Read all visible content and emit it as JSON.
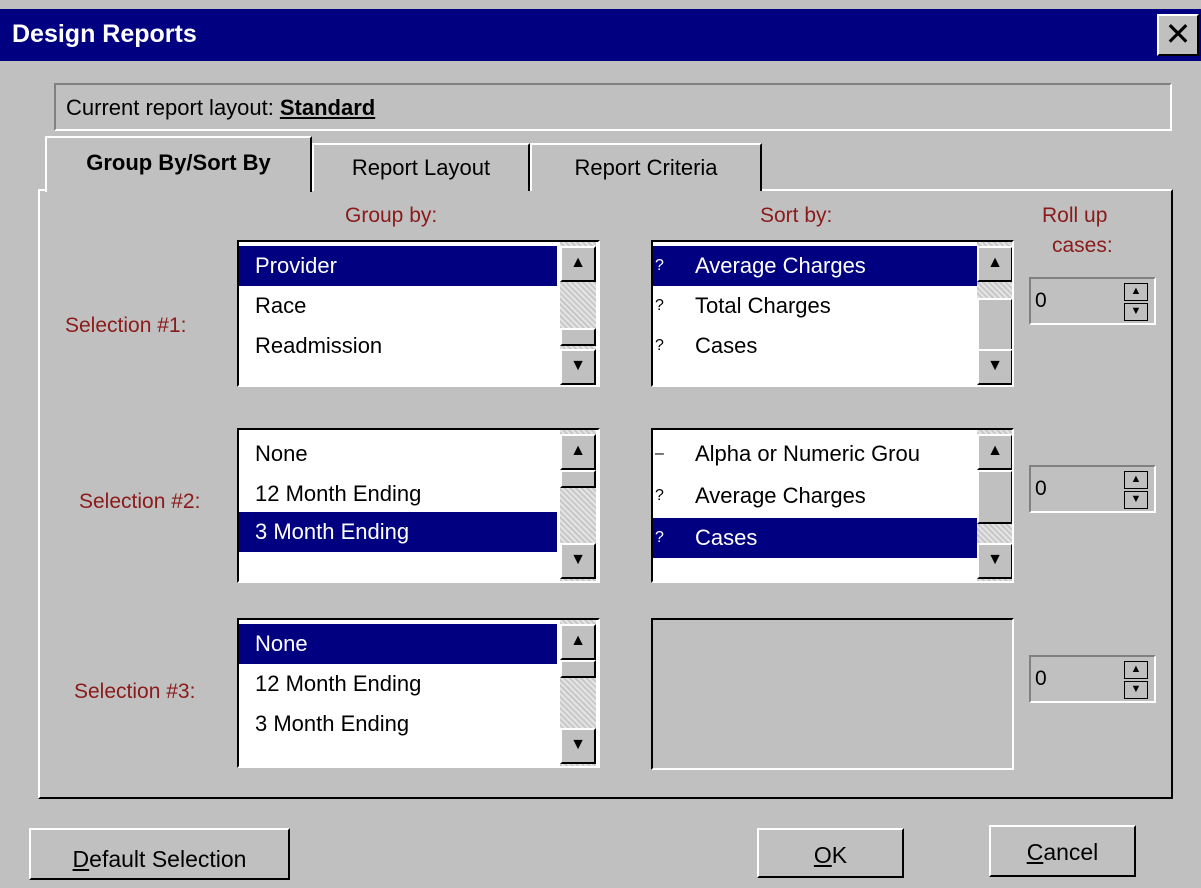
{
  "window": {
    "title": "Design Reports",
    "close_glyph": "✕"
  },
  "layout_bar": {
    "label": "Current report layout:",
    "value": "Standard"
  },
  "tabs": [
    {
      "label": "Group By/Sort By",
      "active": true
    },
    {
      "label": "Report Layout",
      "active": false
    },
    {
      "label": "Report Criteria",
      "active": false
    }
  ],
  "headers": {
    "group_by": "Group by:",
    "sort_by": "Sort by:",
    "roll_up_line1": "Roll up",
    "roll_up_line2": "cases:"
  },
  "selections": [
    {
      "label": "Selection #1:",
      "group_items": [
        {
          "text": "Provider",
          "selected": true
        },
        {
          "text": "Race",
          "selected": false
        },
        {
          "text": "Readmission",
          "selected": false
        }
      ],
      "sort_items": [
        {
          "mark": "?",
          "text": "Average Charges",
          "selected": true
        },
        {
          "mark": "?",
          "text": "Total Charges",
          "selected": false
        },
        {
          "mark": "?",
          "text": "Cases",
          "selected": false
        }
      ],
      "roll_up": "0"
    },
    {
      "label": "Selection #2:",
      "group_items": [
        {
          "text": "None",
          "selected": false
        },
        {
          "text": "12 Month Ending",
          "selected": false
        },
        {
          "text": "3 Month Ending",
          "selected": true
        }
      ],
      "sort_items": [
        {
          "mark": "–",
          "text": "Alpha or Numeric Grou",
          "selected": false
        },
        {
          "mark": "?",
          "text": "Average Charges",
          "selected": false
        },
        {
          "mark": "?",
          "text": "Cases",
          "selected": true
        }
      ],
      "roll_up": "0"
    },
    {
      "label": "Selection #3:",
      "group_items": [
        {
          "text": "None",
          "selected": true
        },
        {
          "text": "12 Month Ending",
          "selected": false
        },
        {
          "text": "3 Month Ending",
          "selected": false
        }
      ],
      "sort_items": [],
      "roll_up": "0"
    }
  ],
  "buttons": {
    "default_selection": {
      "mnemonic": "D",
      "rest": "efault Selection"
    },
    "ok": {
      "mnemonic": "O",
      "rest": "K"
    },
    "cancel": {
      "mnemonic": "C",
      "rest": "ancel"
    }
  },
  "icons": {
    "scroll_up": "up-arrow-icon",
    "scroll_down": "down-arrow-icon",
    "spin_up": "▲",
    "spin_down": "▼"
  },
  "colors": {
    "title_bar": "#000080",
    "selection": "#000080",
    "label_red": "#8b1a1a",
    "face": "#c0c0c0"
  }
}
